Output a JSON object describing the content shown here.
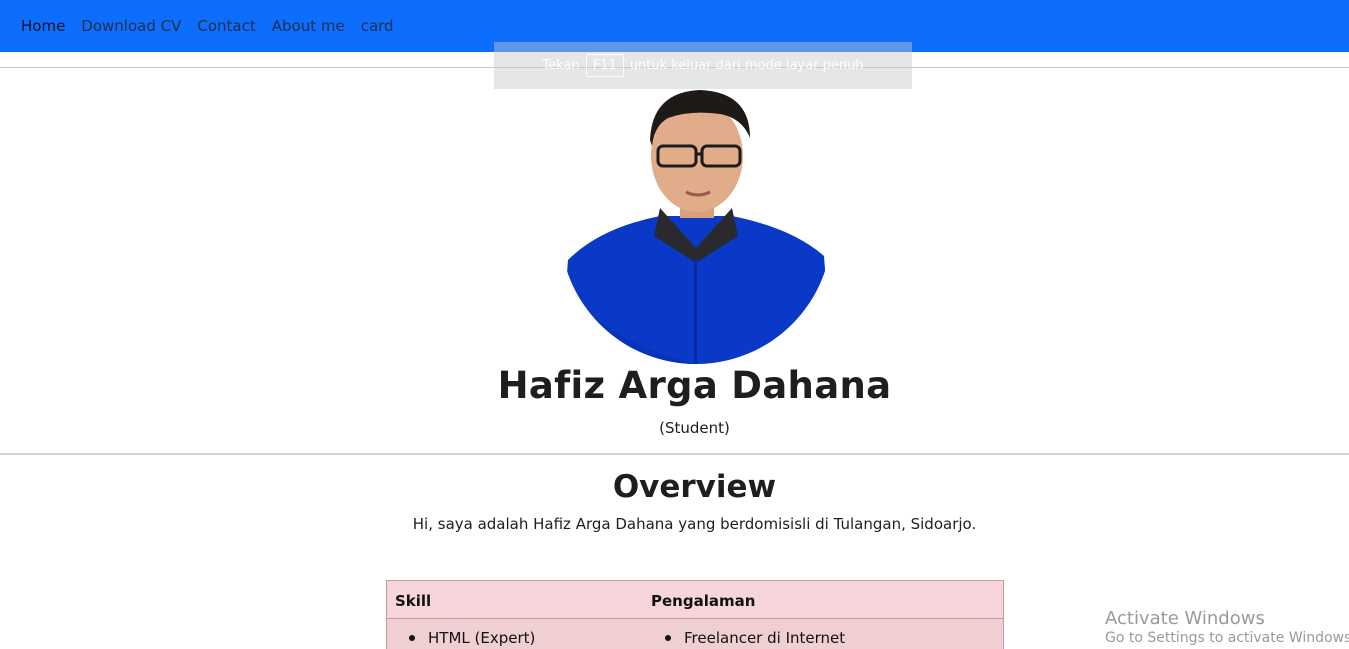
{
  "nav": {
    "items": [
      "Home",
      "Download CV",
      "Contact",
      "About me",
      "card"
    ]
  },
  "fullscreen_hint": {
    "before": "Tekan",
    "key": "F11",
    "after": "untuk keluar dari mode layar penuh"
  },
  "profile": {
    "name": "Hafiz Arga Dahana",
    "role": "(Student)"
  },
  "overview": {
    "title": "Overview",
    "text": "Hi, saya adalah Hafiz Arga Dahana yang berdomisisli di Tulangan, Sidoarjo."
  },
  "table": {
    "headers": [
      "Skill",
      "Pengalaman"
    ],
    "skill_items": [
      "HTML (Expert)"
    ],
    "experience_items": [
      "Freelancer di Internet"
    ]
  },
  "watermark": {
    "line1": "Activate Windows",
    "line2": "Go to Settings to activate Windows."
  },
  "colors": {
    "navbar": "#0d6efd",
    "table_header": "#f6d6da",
    "table_body": "#f0cfd3"
  }
}
